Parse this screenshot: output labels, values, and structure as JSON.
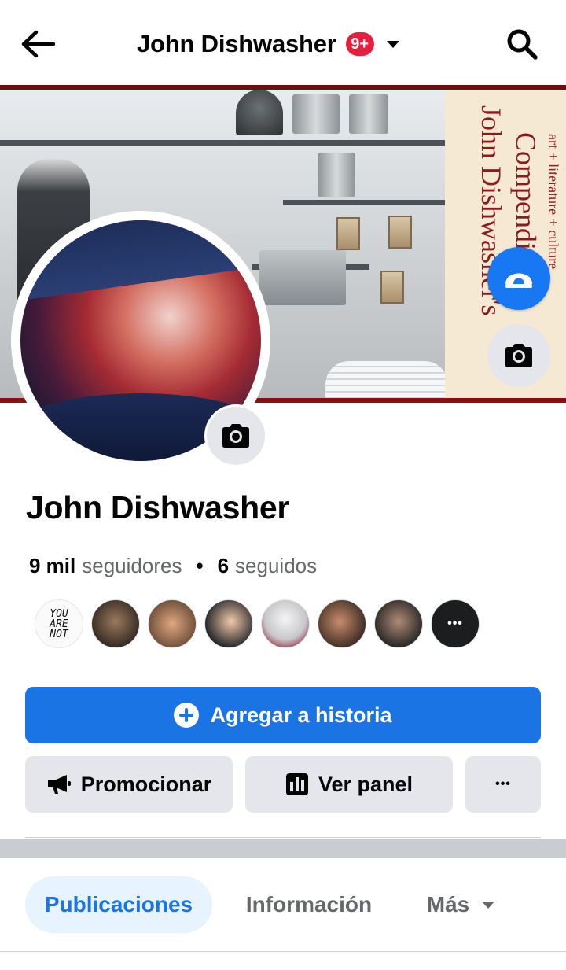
{
  "header": {
    "title": "John Dishwasher",
    "notification_badge": "9+",
    "back_icon": "arrow-left-icon",
    "search_icon": "search-icon",
    "dropdown_icon": "caret-down-icon"
  },
  "cover": {
    "banner_title_line1": "John Dishwasher's",
    "banner_title_line2": "Compendium",
    "banner_subtitle": "art + literature + culture",
    "app_button_icon": "app-logo-icon",
    "camera_icon": "camera-icon"
  },
  "profile": {
    "name": "John Dishwasher",
    "followers_count": "9 mil",
    "followers_label": "seguidores",
    "separator": "•",
    "following_count": "6",
    "following_label": "seguidos",
    "avatar_camera_icon": "camera-icon",
    "follower_avatars": [
      {
        "text": "YOU\nARE\nNOT"
      },
      {
        "text": ""
      },
      {
        "text": ""
      },
      {
        "text": ""
      },
      {
        "text": ""
      },
      {
        "text": ""
      },
      {
        "text": ""
      }
    ],
    "more_followers_label": "•••"
  },
  "actions": {
    "add_story": "Agregar a historia",
    "promote": "Promocionar",
    "view_panel": "Ver panel",
    "more": "•••"
  },
  "tabs": [
    {
      "label": "Publicaciones",
      "active": true
    },
    {
      "label": "Información",
      "active": false
    },
    {
      "label": "Más",
      "active": false
    }
  ],
  "colors": {
    "primary": "#1b74e4",
    "badge": "#e41e3f",
    "secondary_bg": "#e4e6eb",
    "active_tab_bg": "#e7f3ff",
    "cover_border": "#8b1010"
  }
}
